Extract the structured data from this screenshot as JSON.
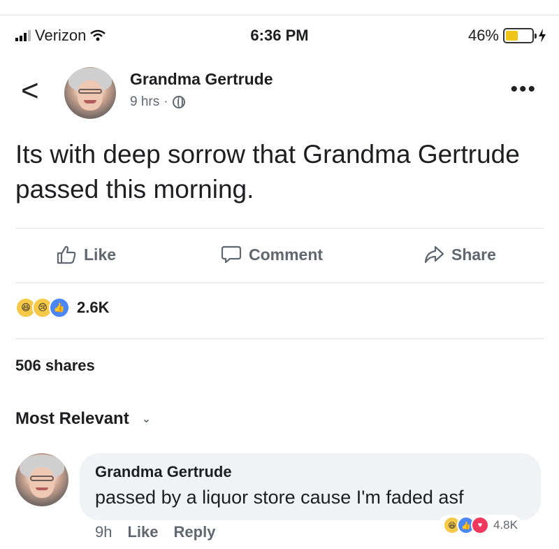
{
  "status_bar": {
    "carrier": "Verizon",
    "time": "6:36 PM",
    "battery_percent": "46%",
    "battery_level": 0.46
  },
  "post": {
    "author": "Grandma Gertrude",
    "time_ago": "9 hrs",
    "meta_separator": "·",
    "text": "Its with deep sorrow that Grandma Gertrude passed this morning."
  },
  "actions": {
    "like_label": "Like",
    "comment_label": "Comment",
    "share_label": "Share"
  },
  "reactions": {
    "icons": [
      "haha-icon",
      "sad-icon",
      "like-icon"
    ],
    "count": "2.6K"
  },
  "shares_text": "506 shares",
  "sort_label": "Most Relevant",
  "comment": {
    "author": "Grandma Gertrude",
    "text": "passed by a liquor store cause I'm faded asf",
    "time": "9h",
    "like_label": "Like",
    "reply_label": "Reply",
    "reaction_icons": [
      "haha-icon",
      "like-icon",
      "love-icon"
    ],
    "reaction_count": "4.8K"
  },
  "colors": {
    "secondary_text": "#606770",
    "like_blue": "#4a87f5",
    "love_red": "#f0385c",
    "emoji_yellow": "#f7c948",
    "bubble_bg": "#f0f2f5"
  }
}
